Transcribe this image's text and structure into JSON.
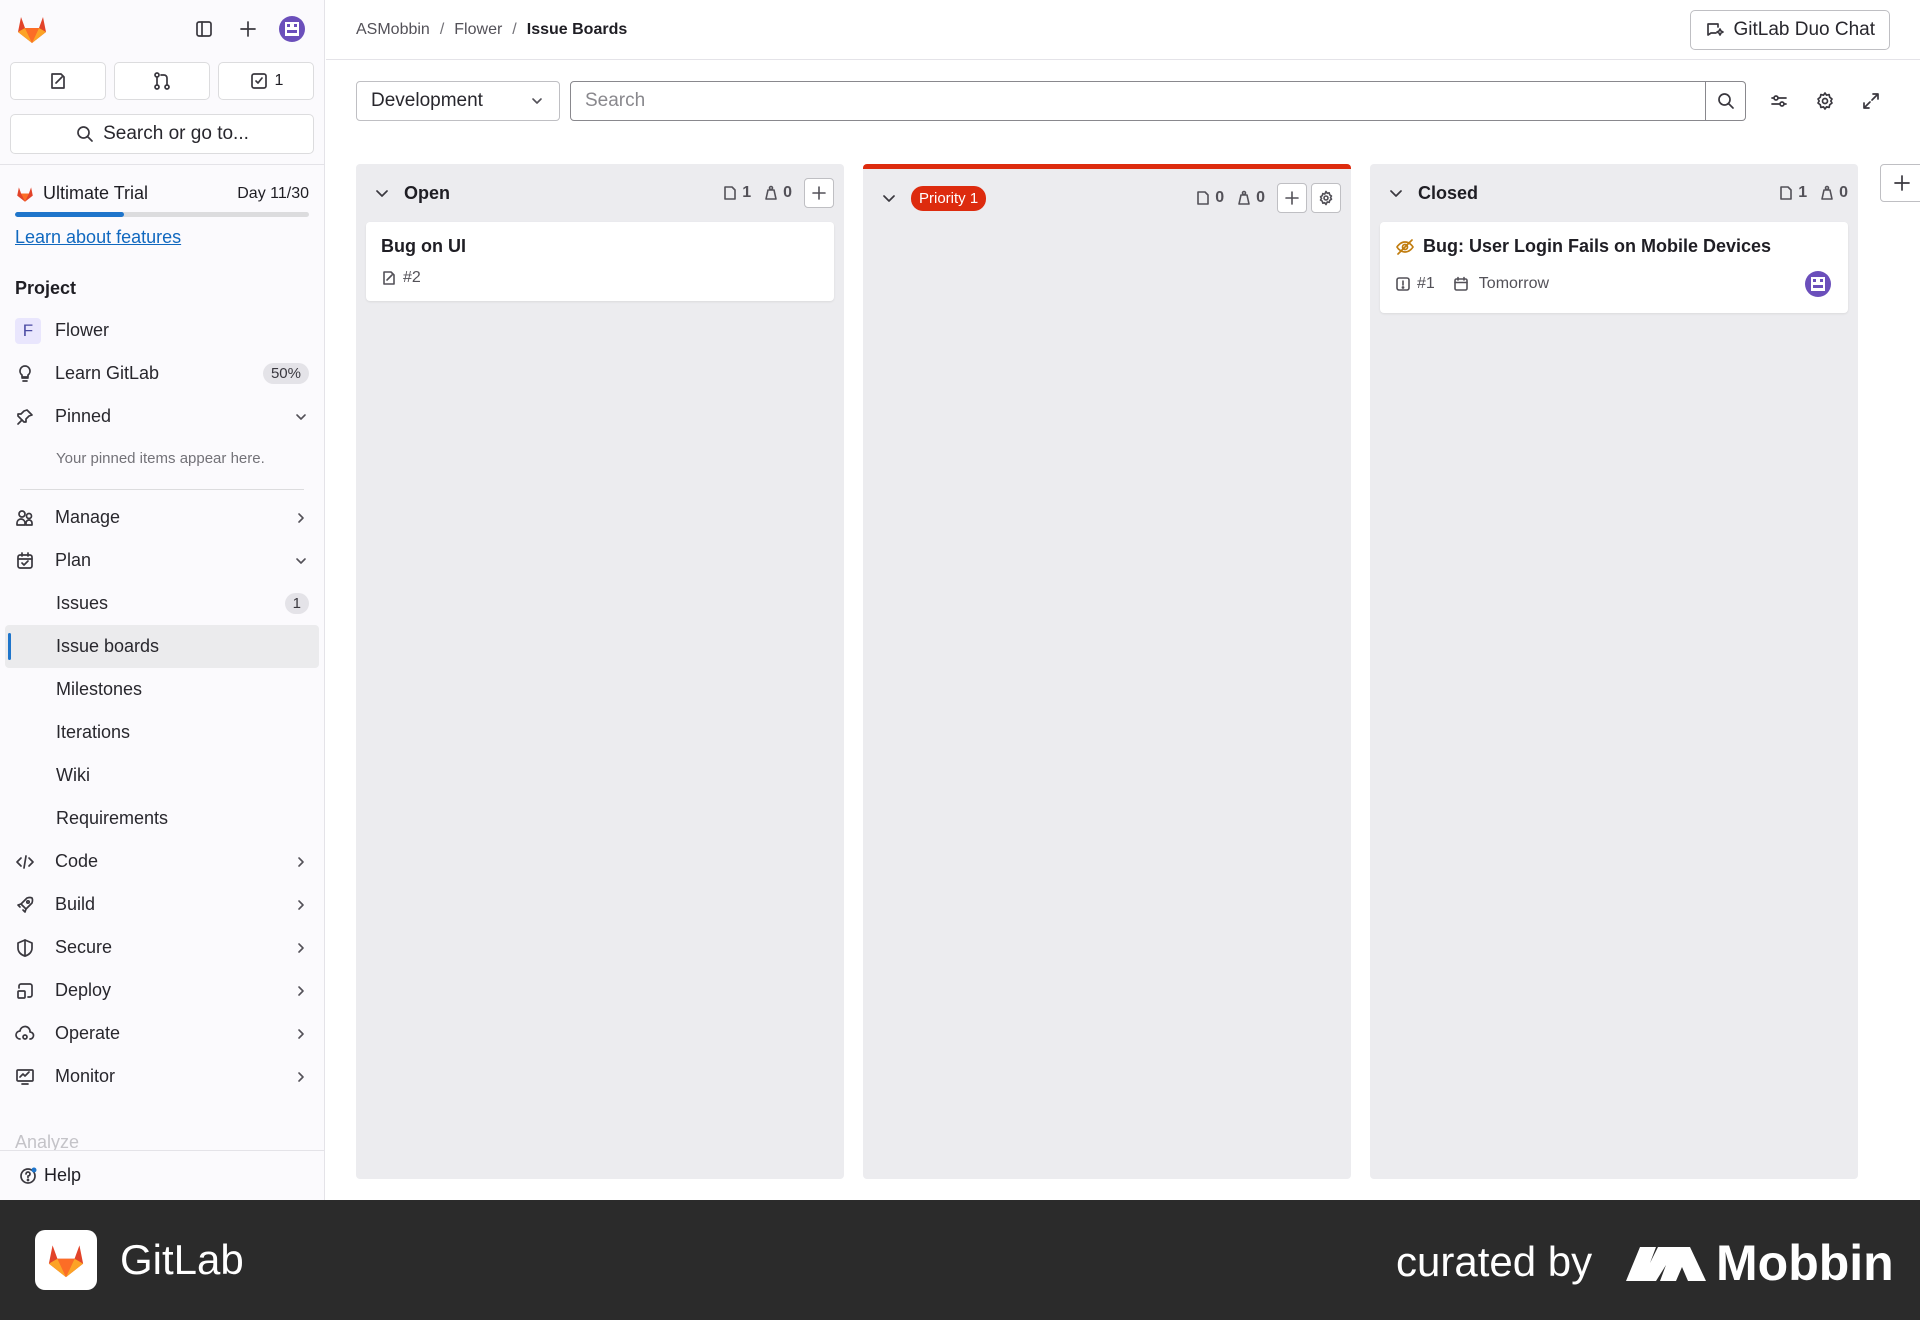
{
  "sidebar": {
    "tabs": [
      {
        "icon": "issues-icon",
        "count": ""
      },
      {
        "icon": "merge-request-icon",
        "count": ""
      },
      {
        "icon": "todo-icon",
        "count": "1"
      }
    ],
    "search_label": "Search or go to...",
    "trial": {
      "label": "Ultimate Trial",
      "day": "Day 11/30",
      "progress": 0.37,
      "link": "Learn about features"
    },
    "section_title": "Project",
    "project": {
      "letter": "F",
      "name": "Flower"
    },
    "learn": {
      "label": "Learn GitLab",
      "pct": "50%"
    },
    "pinned": {
      "label": "Pinned",
      "note": "Your pinned items appear here."
    },
    "manage": "Manage",
    "plan": "Plan",
    "plan_items": [
      {
        "label": "Issues",
        "count": "1"
      },
      {
        "label": "Issue boards",
        "count": ""
      },
      {
        "label": "Milestones",
        "count": ""
      },
      {
        "label": "Iterations",
        "count": ""
      },
      {
        "label": "Wiki",
        "count": ""
      },
      {
        "label": "Requirements",
        "count": ""
      }
    ],
    "groups": [
      "Code",
      "Build",
      "Secure",
      "Deploy",
      "Operate",
      "Monitor"
    ],
    "faded": "Analyze",
    "help": "Help"
  },
  "breadcrumb": [
    "ASMobbin",
    "Flower",
    "Issue Boards"
  ],
  "duo_label": "GitLab Duo Chat",
  "filter": {
    "board": "Development",
    "search_placeholder": "Search"
  },
  "lists": [
    {
      "title": "Open",
      "issues": "1",
      "weight": "0",
      "card": {
        "title": "Bug on UI",
        "ref": "#2"
      }
    },
    {
      "title": "Priority 1",
      "issues": "0",
      "weight": "0",
      "color": "#dd2b0e"
    },
    {
      "title": "Closed",
      "issues": "1",
      "weight": "0",
      "card": {
        "title": "Bug: User Login Fails on Mobile Devices",
        "ref": "#1",
        "due": "Tomorrow"
      }
    }
  ],
  "footer": {
    "app": "GitLab",
    "curated": "curated by",
    "brand": "Mobbin"
  }
}
